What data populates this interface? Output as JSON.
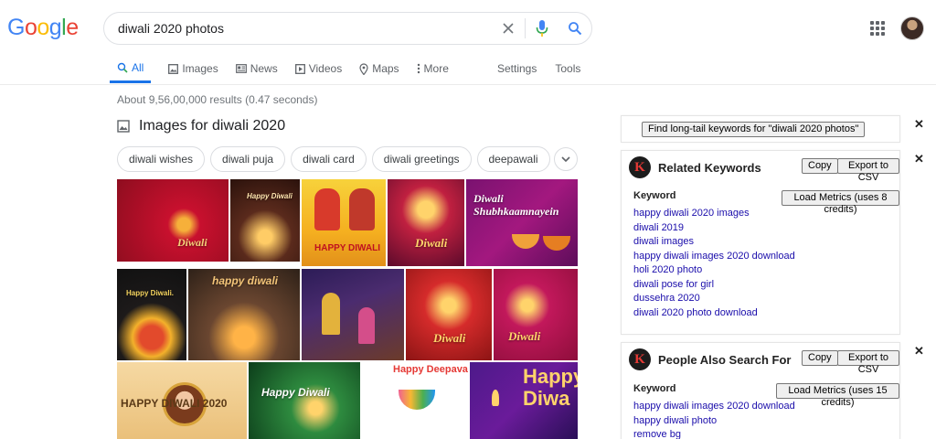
{
  "logo": {
    "letters": [
      "G",
      "o",
      "o",
      "g",
      "l",
      "e"
    ],
    "colors": [
      "#4285F4",
      "#EA4335",
      "#FBBC05",
      "#4285F4",
      "#34A853",
      "#EA4335"
    ]
  },
  "search": {
    "query": "diwali 2020 photos"
  },
  "tabs": [
    {
      "label": "All",
      "icon": "search-icon",
      "active": true
    },
    {
      "label": "Images",
      "icon": "image-icon"
    },
    {
      "label": "News",
      "icon": "news-icon"
    },
    {
      "label": "Videos",
      "icon": "video-icon"
    },
    {
      "label": "Maps",
      "icon": "map-pin-icon"
    },
    {
      "label": "More",
      "icon": "more-vert-icon"
    }
  ],
  "tools": {
    "settings": "Settings",
    "tools": "Tools"
  },
  "results_stats": "About 9,56,00,000 results (0.47 seconds)",
  "images_section": {
    "title": "Images for diwali 2020"
  },
  "chips": [
    "diwali wishes",
    "diwali puja",
    "diwali card",
    "diwali greetings",
    "deepawali"
  ],
  "images": [
    {
      "caption": "Diwali"
    },
    {
      "caption": "Happy Diwali"
    },
    {
      "caption": "HAPPY DIWALI"
    },
    {
      "caption": "Diwali"
    },
    {
      "caption": "Diwali Shubhkaamnayein"
    },
    {
      "caption": "Happy Diwali."
    },
    {
      "caption": "happy diwali"
    },
    {
      "caption": ""
    },
    {
      "caption": "Diwali"
    },
    {
      "caption": "Diwali"
    },
    {
      "caption": "HAPPY DIWALI 2020"
    },
    {
      "caption": "Happy Diwali"
    },
    {
      "caption": "Happy Deepavali"
    },
    {
      "caption": "Happy Diwa"
    }
  ],
  "longtail": {
    "button": "Find long-tail keywords for \"diwali 2020 photos\""
  },
  "related": {
    "title": "Related Keywords",
    "copy": "Copy",
    "export": "Export to CSV",
    "column": "Keyword",
    "load": "Load Metrics (uses 8 credits)",
    "items": [
      "happy diwali 2020 images",
      "diwali 2019",
      "diwali images",
      "happy diwali images 2020 download",
      "holi 2020 photo",
      "diwali pose for girl",
      "dussehra 2020",
      "diwali 2020 photo download"
    ]
  },
  "people": {
    "title": "People Also Search For",
    "copy": "Copy",
    "export": "Export to CSV",
    "column": "Keyword",
    "load": "Load Metrics (uses 15 credits)",
    "items": [
      "happy diwali images 2020 download",
      "happy diwali photo",
      "remove bg"
    ]
  },
  "close": "✕",
  "k_logo": "K"
}
